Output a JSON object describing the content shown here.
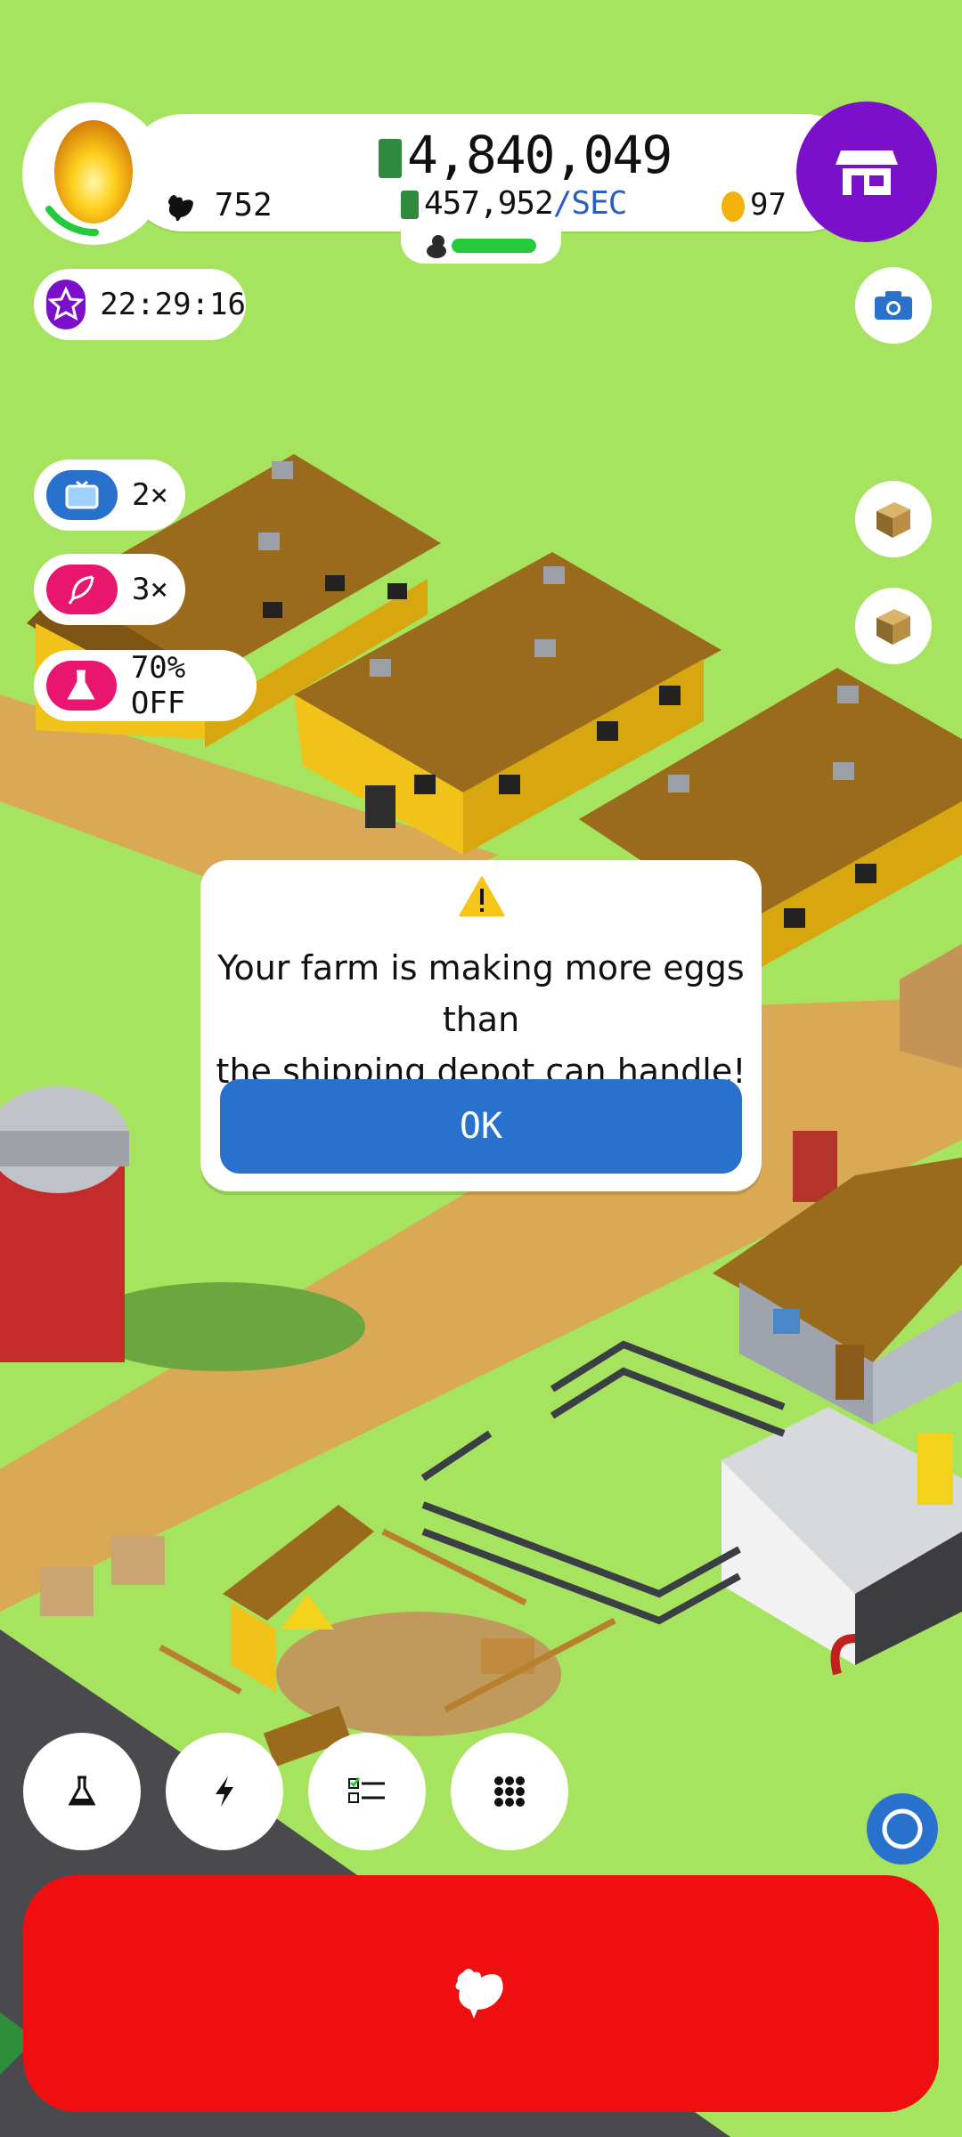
{
  "hud": {
    "money": "4,840,049",
    "rate_value": "457,952",
    "rate_unit": "/SEC",
    "chickens": "752",
    "golden_eggs": "97",
    "hab_capacity_fraction": 0.85
  },
  "boosts": {
    "event_timer": "22:29:16",
    "video_multiplier": "2×",
    "earnings_multiplier": "3×",
    "research_discount": "70% OFF"
  },
  "dialog": {
    "message_line1": "Your farm is making more eggs than",
    "message_line2": "the shipping depot can handle!",
    "ok_label": "OK",
    "icon": "warning-icon"
  },
  "colors": {
    "shop": "#7a10c9",
    "ok_button": "#2872cd",
    "hatch_button": "#ef0e10",
    "grass": "#a6e35f",
    "progress": "#24c93c"
  },
  "icons": {
    "shop": "shop-icon",
    "camera": "camera-icon",
    "box": "box-icon",
    "research": "flask-icon",
    "boost": "lightning-icon",
    "missions": "checklist-icon",
    "menu": "grid-icon",
    "hatch": "chicken-icon"
  }
}
